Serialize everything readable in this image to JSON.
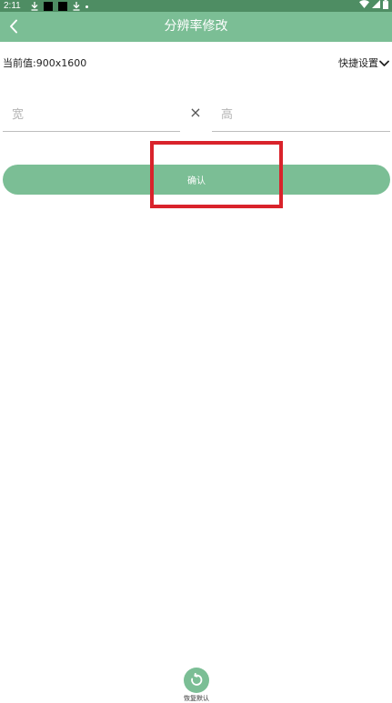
{
  "status_bar": {
    "time": "2:11"
  },
  "app_bar": {
    "title": "分辨率修改"
  },
  "resolution": {
    "current_value": "当前值:900x1600",
    "quick_settings_label": "快捷设置",
    "width_placeholder": "宽",
    "height_placeholder": "高",
    "times_symbol": "×"
  },
  "confirm": {
    "label": "确认"
  },
  "reset": {
    "label": "恢复默认"
  },
  "colors": {
    "status_bar": "#4e8d63",
    "accent": "#7bbe95",
    "highlight": "#d9232b"
  }
}
